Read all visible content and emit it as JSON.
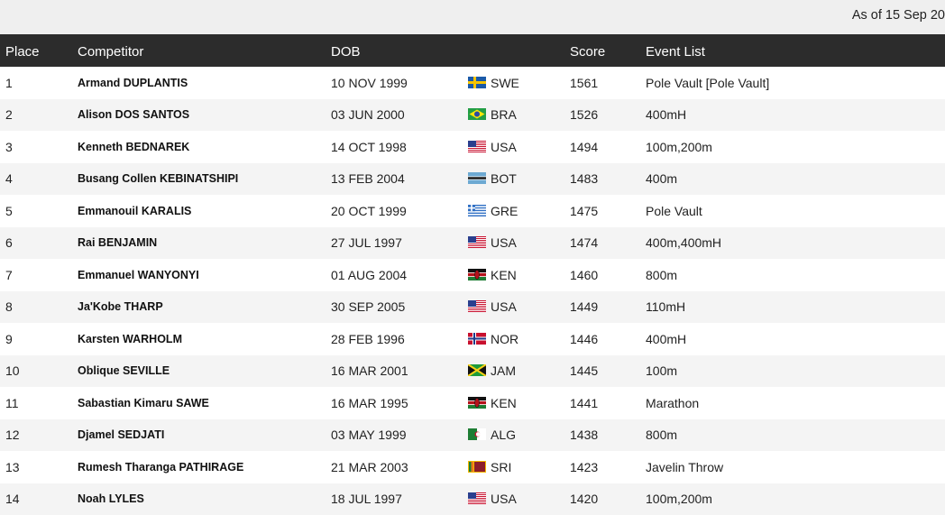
{
  "header": {
    "as_of": "As of 15 Sep 20"
  },
  "table": {
    "columns": {
      "place": "Place",
      "competitor": "Competitor",
      "dob": "DOB",
      "nat": "",
      "score": "Score",
      "events": "Event List"
    },
    "rows": [
      {
        "place": "1",
        "name": "Armand DUPLANTIS",
        "dob": "10 NOV 1999",
        "country": "SWE",
        "flag": "flag-sweden",
        "score": "1561",
        "events": "Pole Vault [Pole Vault]"
      },
      {
        "place": "2",
        "name": "Alison DOS SANTOS",
        "dob": "03 JUN 2000",
        "country": "BRA",
        "flag": "flag-brazil",
        "score": "1526",
        "events": "400mH"
      },
      {
        "place": "3",
        "name": "Kenneth BEDNAREK",
        "dob": "14 OCT 1998",
        "country": "USA",
        "flag": "flag-usa",
        "score": "1494",
        "events": "100m,200m"
      },
      {
        "place": "4",
        "name": "Busang Collen KEBINATSHIPI",
        "dob": "13 FEB 2004",
        "country": "BOT",
        "flag": "flag-botswana",
        "score": "1483",
        "events": "400m"
      },
      {
        "place": "5",
        "name": "Emmanouil KARALIS",
        "dob": "20 OCT 1999",
        "country": "GRE",
        "flag": "flag-greece",
        "score": "1475",
        "events": "Pole Vault"
      },
      {
        "place": "6",
        "name": "Rai BENJAMIN",
        "dob": "27 JUL 1997",
        "country": "USA",
        "flag": "flag-usa",
        "score": "1474",
        "events": "400m,400mH"
      },
      {
        "place": "7",
        "name": "Emmanuel WANYONYI",
        "dob": "01 AUG 2004",
        "country": "KEN",
        "flag": "flag-kenya",
        "score": "1460",
        "events": "800m"
      },
      {
        "place": "8",
        "name": "Ja'Kobe THARP",
        "dob": "30 SEP 2005",
        "country": "USA",
        "flag": "flag-usa",
        "score": "1449",
        "events": "110mH"
      },
      {
        "place": "9",
        "name": "Karsten WARHOLM",
        "dob": "28 FEB 1996",
        "country": "NOR",
        "flag": "flag-norway",
        "score": "1446",
        "events": "400mH"
      },
      {
        "place": "10",
        "name": "Oblique SEVILLE",
        "dob": "16 MAR 2001",
        "country": "JAM",
        "flag": "flag-jamaica",
        "score": "1445",
        "events": "100m"
      },
      {
        "place": "11",
        "name": "Sabastian Kimaru SAWE",
        "dob": "16 MAR 1995",
        "country": "KEN",
        "flag": "flag-kenya",
        "score": "1441",
        "events": "Marathon"
      },
      {
        "place": "12",
        "name": "Djamel SEDJATI",
        "dob": "03 MAY 1999",
        "country": "ALG",
        "flag": "flag-algeria",
        "score": "1438",
        "events": "800m"
      },
      {
        "place": "13",
        "name": "Rumesh Tharanga PATHIRAGE",
        "dob": "21 MAR 2003",
        "country": "SRI",
        "flag": "flag-sri-lanka",
        "score": "1423",
        "events": "Javelin Throw"
      },
      {
        "place": "14",
        "name": "Noah LYLES",
        "dob": "18 JUL 1997",
        "country": "USA",
        "flag": "flag-usa",
        "score": "1420",
        "events": "100m,200m"
      }
    ]
  }
}
